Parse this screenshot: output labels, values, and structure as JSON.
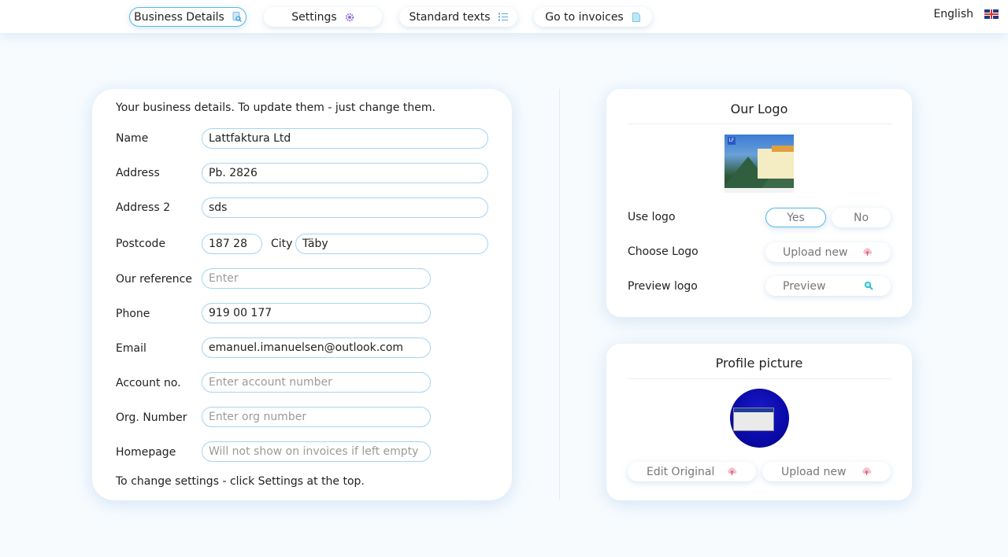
{
  "nav": {
    "items": [
      {
        "label": "Business Details",
        "icon": "search-doc-icon",
        "active": true
      },
      {
        "label": "Settings",
        "icon": "gear-icon",
        "active": false
      },
      {
        "label": "Standard texts",
        "icon": "list-icon",
        "active": false
      },
      {
        "label": "Go to invoices",
        "icon": "document-icon",
        "active": false
      }
    ],
    "language": "English",
    "language_icon": "uk-flag-icon"
  },
  "business": {
    "intro": "Your business details. To update them - just change them.",
    "fields": {
      "name": {
        "label": "Name",
        "value": "Lattfaktura Ltd"
      },
      "address": {
        "label": "Address",
        "value": "Pb. 2826"
      },
      "address2": {
        "label": "Address 2",
        "value": "sds"
      },
      "postcode": {
        "label": "Postcode",
        "value": "187 28"
      },
      "city": {
        "label": "City",
        "value": "Täby"
      },
      "reference": {
        "label": "Our reference",
        "value": "",
        "placeholder": "Enter"
      },
      "phone": {
        "label": "Phone",
        "value": "919 00 177"
      },
      "email": {
        "label": "Email",
        "value": "emanuel.imanuelsen@outlook.com"
      },
      "account": {
        "label": "Account no.",
        "value": "",
        "placeholder": "Enter account number"
      },
      "org": {
        "label": "Org. Number",
        "value": "",
        "placeholder": "Enter org number"
      },
      "homepage": {
        "label": "Homepage",
        "value": "",
        "placeholder": "Will not show on invoices if left empty"
      }
    },
    "outro": "To change settings - click Settings at the top."
  },
  "logo": {
    "title": "Our Logo",
    "use_logo_label": "Use logo",
    "yes_label": "Yes",
    "no_label": "No",
    "use_logo_selected": "Yes",
    "choose_label": "Choose Logo",
    "upload_label": "Upload new",
    "preview_row_label": "Preview logo",
    "preview_label": "Preview",
    "logo_badge": "LF"
  },
  "profile": {
    "title": "Profile picture",
    "edit_label": "Edit Original",
    "upload_label": "Upload new"
  },
  "colors": {
    "accent_border": "#55b9e6",
    "field_border": "#a6d4ef",
    "upload_icon": "#e05a7a",
    "preview_icon": "#17b8c8"
  }
}
